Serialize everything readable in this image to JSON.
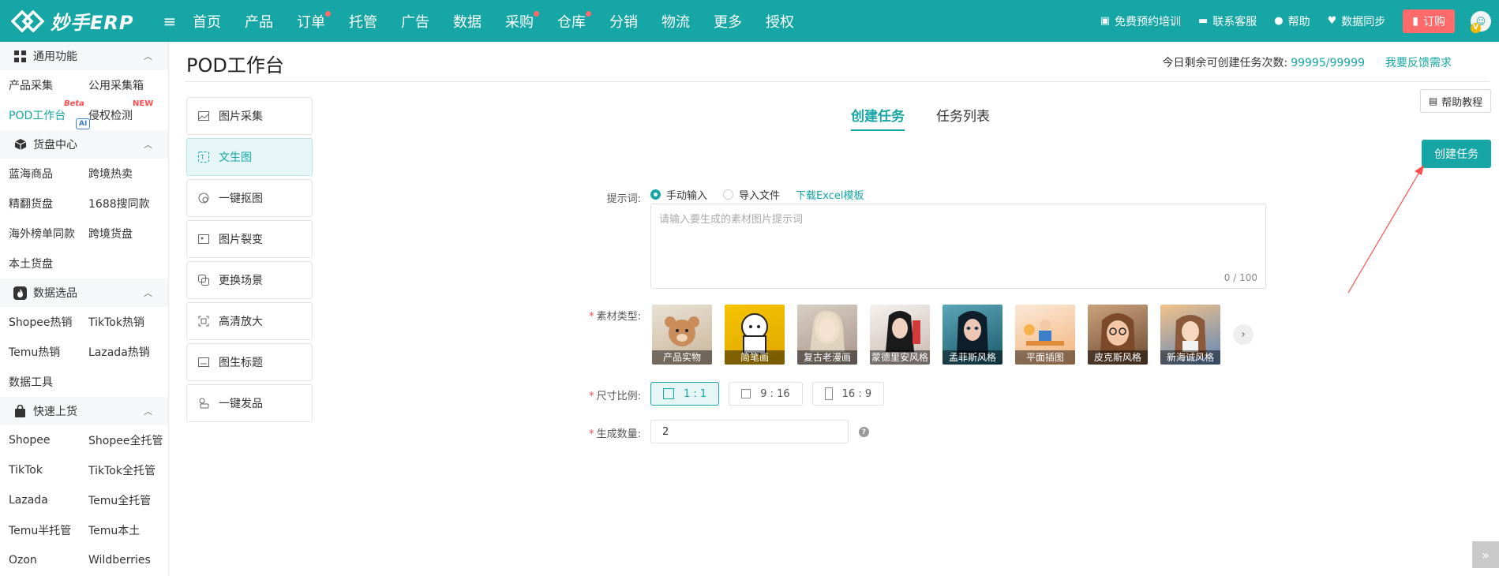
{
  "brand": {
    "name": "妙手ERP",
    "color": "#16a6a6"
  },
  "nav": [
    {
      "label": "首页",
      "dot": false
    },
    {
      "label": "产品",
      "dot": false
    },
    {
      "label": "订单",
      "dot": true
    },
    {
      "label": "托管",
      "dot": false
    },
    {
      "label": "广告",
      "dot": false
    },
    {
      "label": "数据",
      "dot": false
    },
    {
      "label": "采购",
      "dot": true
    },
    {
      "label": "仓库",
      "dot": true
    },
    {
      "label": "分销",
      "dot": false
    },
    {
      "label": "物流",
      "dot": false
    },
    {
      "label": "更多",
      "dot": false
    },
    {
      "label": "授权",
      "dot": false
    }
  ],
  "top_right": {
    "training": "免费预约培训",
    "support": "联系客服",
    "help": "帮助",
    "sync": "数据同步",
    "order": "订购",
    "avatar_badge": "V"
  },
  "sidebar": {
    "groups": [
      {
        "title": "通用功能",
        "icon": "grid-icon",
        "items": [
          "产品采集",
          "公用采集箱",
          "POD工作台",
          "侵权检测"
        ]
      },
      {
        "title": "货盘中心",
        "icon": "cube-icon",
        "items": [
          "蓝海商品",
          "跨境热卖",
          "精翻货盘",
          "1688搜同款",
          "海外榜单同款",
          "跨境货盘",
          "本土货盘"
        ]
      },
      {
        "title": "数据选品",
        "icon": "flame-icon",
        "items": [
          "Shopee热销",
          "TikTok热销",
          "Temu热销",
          "Lazada热销",
          "数据工具"
        ]
      },
      {
        "title": "快速上货",
        "icon": "bag-icon",
        "items": [
          "Shopee",
          "Shopee全托管",
          "TikTok",
          "TikTok全托管",
          "Lazada",
          "Temu全托管",
          "Temu半托管",
          "Temu本土",
          "Ozon",
          "Wildberries"
        ]
      }
    ],
    "badges": {
      "beta": "Beta",
      "new": "NEW",
      "ai": "AI"
    }
  },
  "page": {
    "title": "POD工作台",
    "quota_label": "今日剩余可创建任务次数:",
    "quota_value": "99995/99999",
    "feedback": "我要反馈需求",
    "help_button": "帮助教程",
    "create_button": "创建任务"
  },
  "tools": [
    {
      "label": "图片采集",
      "icon": "image-icon",
      "active": false
    },
    {
      "label": "文生图",
      "icon": "text-to-image-icon",
      "active": true
    },
    {
      "label": "一键抠图",
      "icon": "cutout-icon",
      "active": false
    },
    {
      "label": "图片裂变",
      "icon": "image-variant-icon",
      "active": false
    },
    {
      "label": "更换场景",
      "icon": "scene-icon",
      "active": false
    },
    {
      "label": "高清放大",
      "icon": "upscale-icon",
      "active": false
    },
    {
      "label": "图生标题",
      "icon": "image-title-icon",
      "active": false
    },
    {
      "label": "一键发品",
      "icon": "publish-icon",
      "active": false
    }
  ],
  "tabs": [
    {
      "label": "创建任务",
      "active": true
    },
    {
      "label": "任务列表",
      "active": false
    }
  ],
  "form": {
    "prompt_label": "提示词:",
    "radio_manual": "手动输入",
    "radio_import": "导入文件",
    "download_template": "下载Excel模板",
    "textarea_placeholder": "请输入要生成的素材图片提示词",
    "textarea_counter": "0 / 100",
    "material_label": "素材类型:",
    "materials": [
      "产品实物",
      "简笔画",
      "复古老漫画",
      "蒙德里安风格",
      "孟菲斯风格",
      "平面插图",
      "皮克斯风格",
      "新海诚风格"
    ],
    "ratio_label": "尺寸比例:",
    "ratios": [
      {
        "label": "1 : 1",
        "active": true
      },
      {
        "label": "9 : 16",
        "active": false
      },
      {
        "label": "16 : 9",
        "active": false
      }
    ],
    "count_label": "生成数量:",
    "count_value": "2"
  }
}
